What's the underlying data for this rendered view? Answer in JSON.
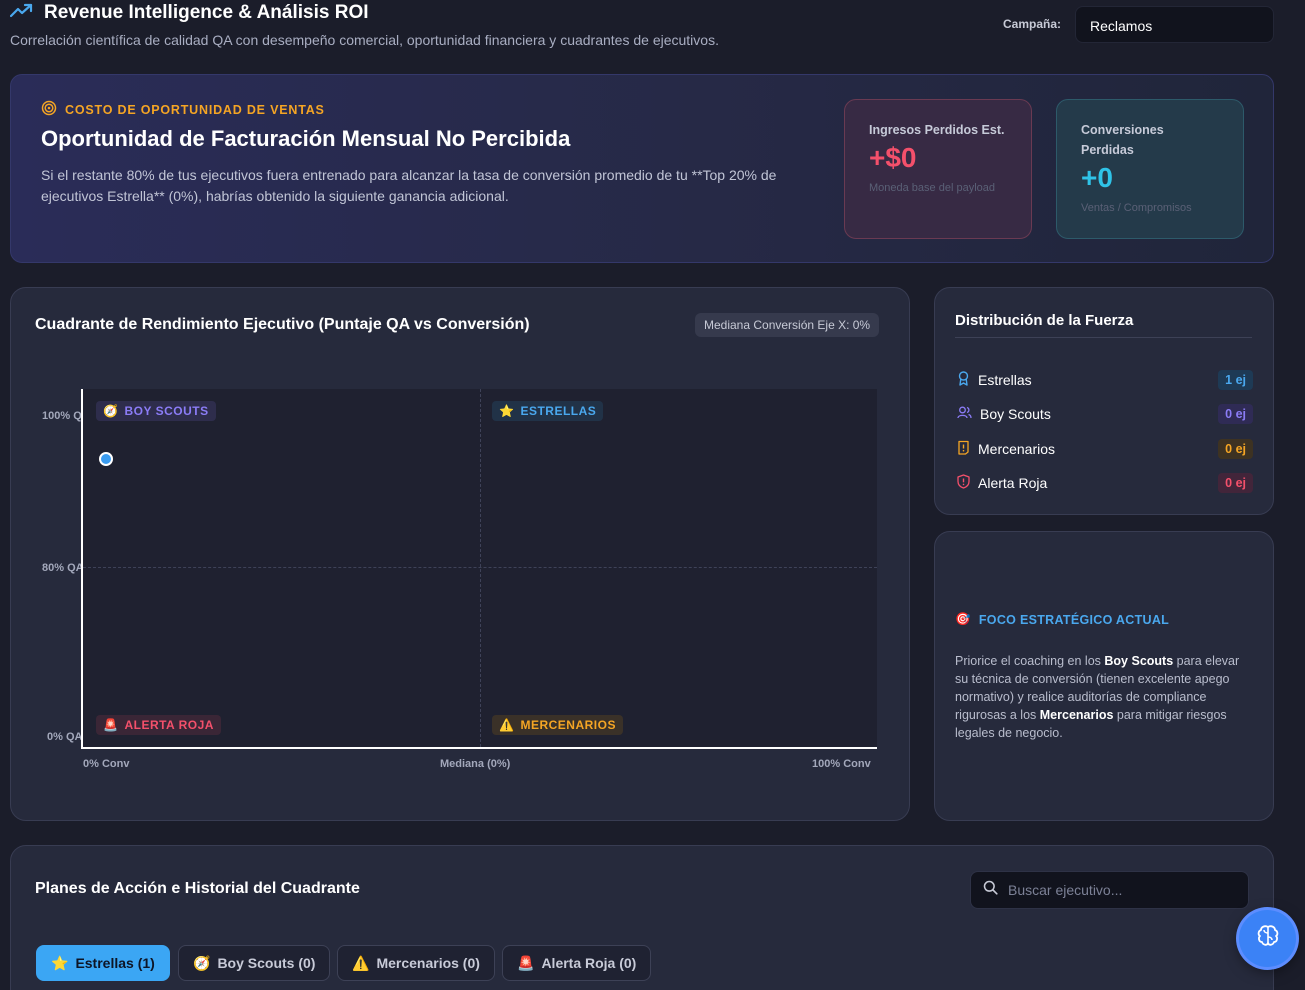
{
  "header": {
    "title": "Revenue Intelligence & Análisis ROI",
    "subtitle": "Correlación científica de calidad QA con desempeño comercial, oportunidad financiera y cuadrantes de ejecutivos.",
    "campaign_label": "Campaña:",
    "campaign_value": "Reclamos"
  },
  "hero": {
    "kicker": "COSTO DE OPORTUNIDAD DE VENTAS",
    "title": "Oportunidad de Facturación Mensual No Percibida",
    "text": "Si el restante 80% de tus ejecutivos fuera entrenado para alcanzar la tasa de conversión promedio de tu **Top 20% de ejecutivos Estrella** (0%), habrías obtenido la siguiente ganancia adicional.",
    "kpi_revenue": {
      "label": "Ingresos Perdidos Est.",
      "value": "+$0",
      "sub": "Moneda base del payload"
    },
    "kpi_conversions": {
      "label": "Conversiones Perdidas",
      "value": "+0",
      "sub": "Ventas / Compromisos"
    }
  },
  "quadrant": {
    "title": "Cuadrante de Rendimiento Ejecutivo (Puntaje QA vs Conversión)",
    "median_badge": "Mediana Conversión Eje X: 0%",
    "tags": {
      "boy_scouts": "BOY SCOUTS",
      "estrellas": "ESTRELLAS",
      "alerta_roja": "ALERTA ROJA",
      "mercenarios": "MERCENARIOS"
    },
    "y_ticks": [
      "100% QA",
      "80% QA",
      "0% QA"
    ],
    "x_ticks": [
      "0% Conv",
      "Mediana (0%)",
      "100% Conv"
    ]
  },
  "chart_data": {
    "type": "scatter",
    "title": "Cuadrante de Rendimiento Ejecutivo (Puntaje QA vs Conversión)",
    "xlabel": "",
    "ylabel": "",
    "xlim": [
      0,
      100
    ],
    "points": [
      {
        "x": 2,
        "y": 94
      }
    ],
    "median_x": 0,
    "threshold_y": 80,
    "colors": {
      "point": "#3b9cf0"
    }
  },
  "distribution": {
    "title": "Distribución de la Fuerza",
    "items": [
      {
        "label": "Estrellas",
        "count": "1 ej",
        "color": "#4aa8ee"
      },
      {
        "label": "Boy Scouts",
        "count": "0 ej",
        "color": "#8b7cf6"
      },
      {
        "label": "Mercenarios",
        "count": "0 ej",
        "color": "#f5a524"
      },
      {
        "label": "Alerta Roja",
        "count": "0 ej",
        "color": "#f4506b"
      }
    ]
  },
  "focus": {
    "title": "FOCO ESTRATÉGICO ACTUAL",
    "text_1": "Priorice el coaching en los ",
    "bold_1": "Boy Scouts",
    "text_2": " para elevar su técnica de conversión (tienen excelente apego normativo) y realice auditorías de compliance rigurosas a los ",
    "bold_2": "Mercenarios",
    "text_3": " para mitigar riesgos legales de negocio."
  },
  "plans": {
    "title": "Planes de Acción e Historial del Cuadrante",
    "search_placeholder": "Buscar ejecutivo...",
    "tabs": [
      "Estrellas (1)",
      "Boy Scouts (0)",
      "Mercenarios (0)",
      "Alerta Roja (0)"
    ]
  },
  "icons": {
    "title": "trending-up-icon",
    "kicker": "target-icon",
    "fab": "brain-icon"
  }
}
